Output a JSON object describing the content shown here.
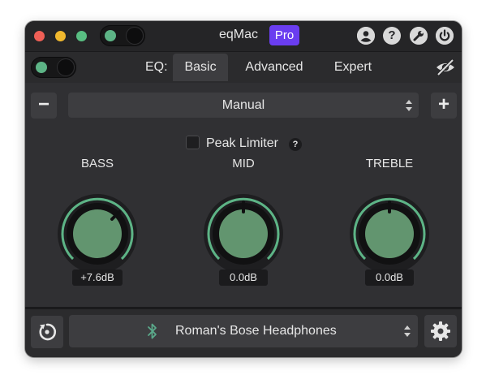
{
  "titlebar": {
    "app_name": "eqMac",
    "badge": "Pro",
    "icons": [
      "account-icon",
      "help-icon",
      "wrench-icon",
      "power-icon"
    ],
    "help_glyph": "?"
  },
  "toolbar": {
    "eq_label": "EQ:",
    "tabs": [
      {
        "label": "Basic",
        "active": true
      },
      {
        "label": "Advanced",
        "active": false
      },
      {
        "label": "Expert",
        "active": false
      }
    ],
    "visibility_icon": "eye-slash-icon"
  },
  "preset": {
    "remove_label": "−",
    "selected": "Manual",
    "add_label": "+"
  },
  "peak_limiter": {
    "label": "Peak Limiter",
    "checked": false,
    "help": "?"
  },
  "knobs": [
    {
      "label": "BASS",
      "value_text": "+7.6dB",
      "value_db": 7.6
    },
    {
      "label": "MID",
      "value_text": "0.0dB",
      "value_db": 0.0
    },
    {
      "label": "TREBLE",
      "value_text": "0.0dB",
      "value_db": 0.0
    }
  ],
  "output": {
    "device_name": "Roman's Bose Headphones",
    "device_icon": "bluetooth-icon",
    "reset_icon": "reset-icon",
    "settings_icon": "gear-icon"
  },
  "colors": {
    "accent_green": "#5db486",
    "pro_badge": "#6a3df0"
  }
}
